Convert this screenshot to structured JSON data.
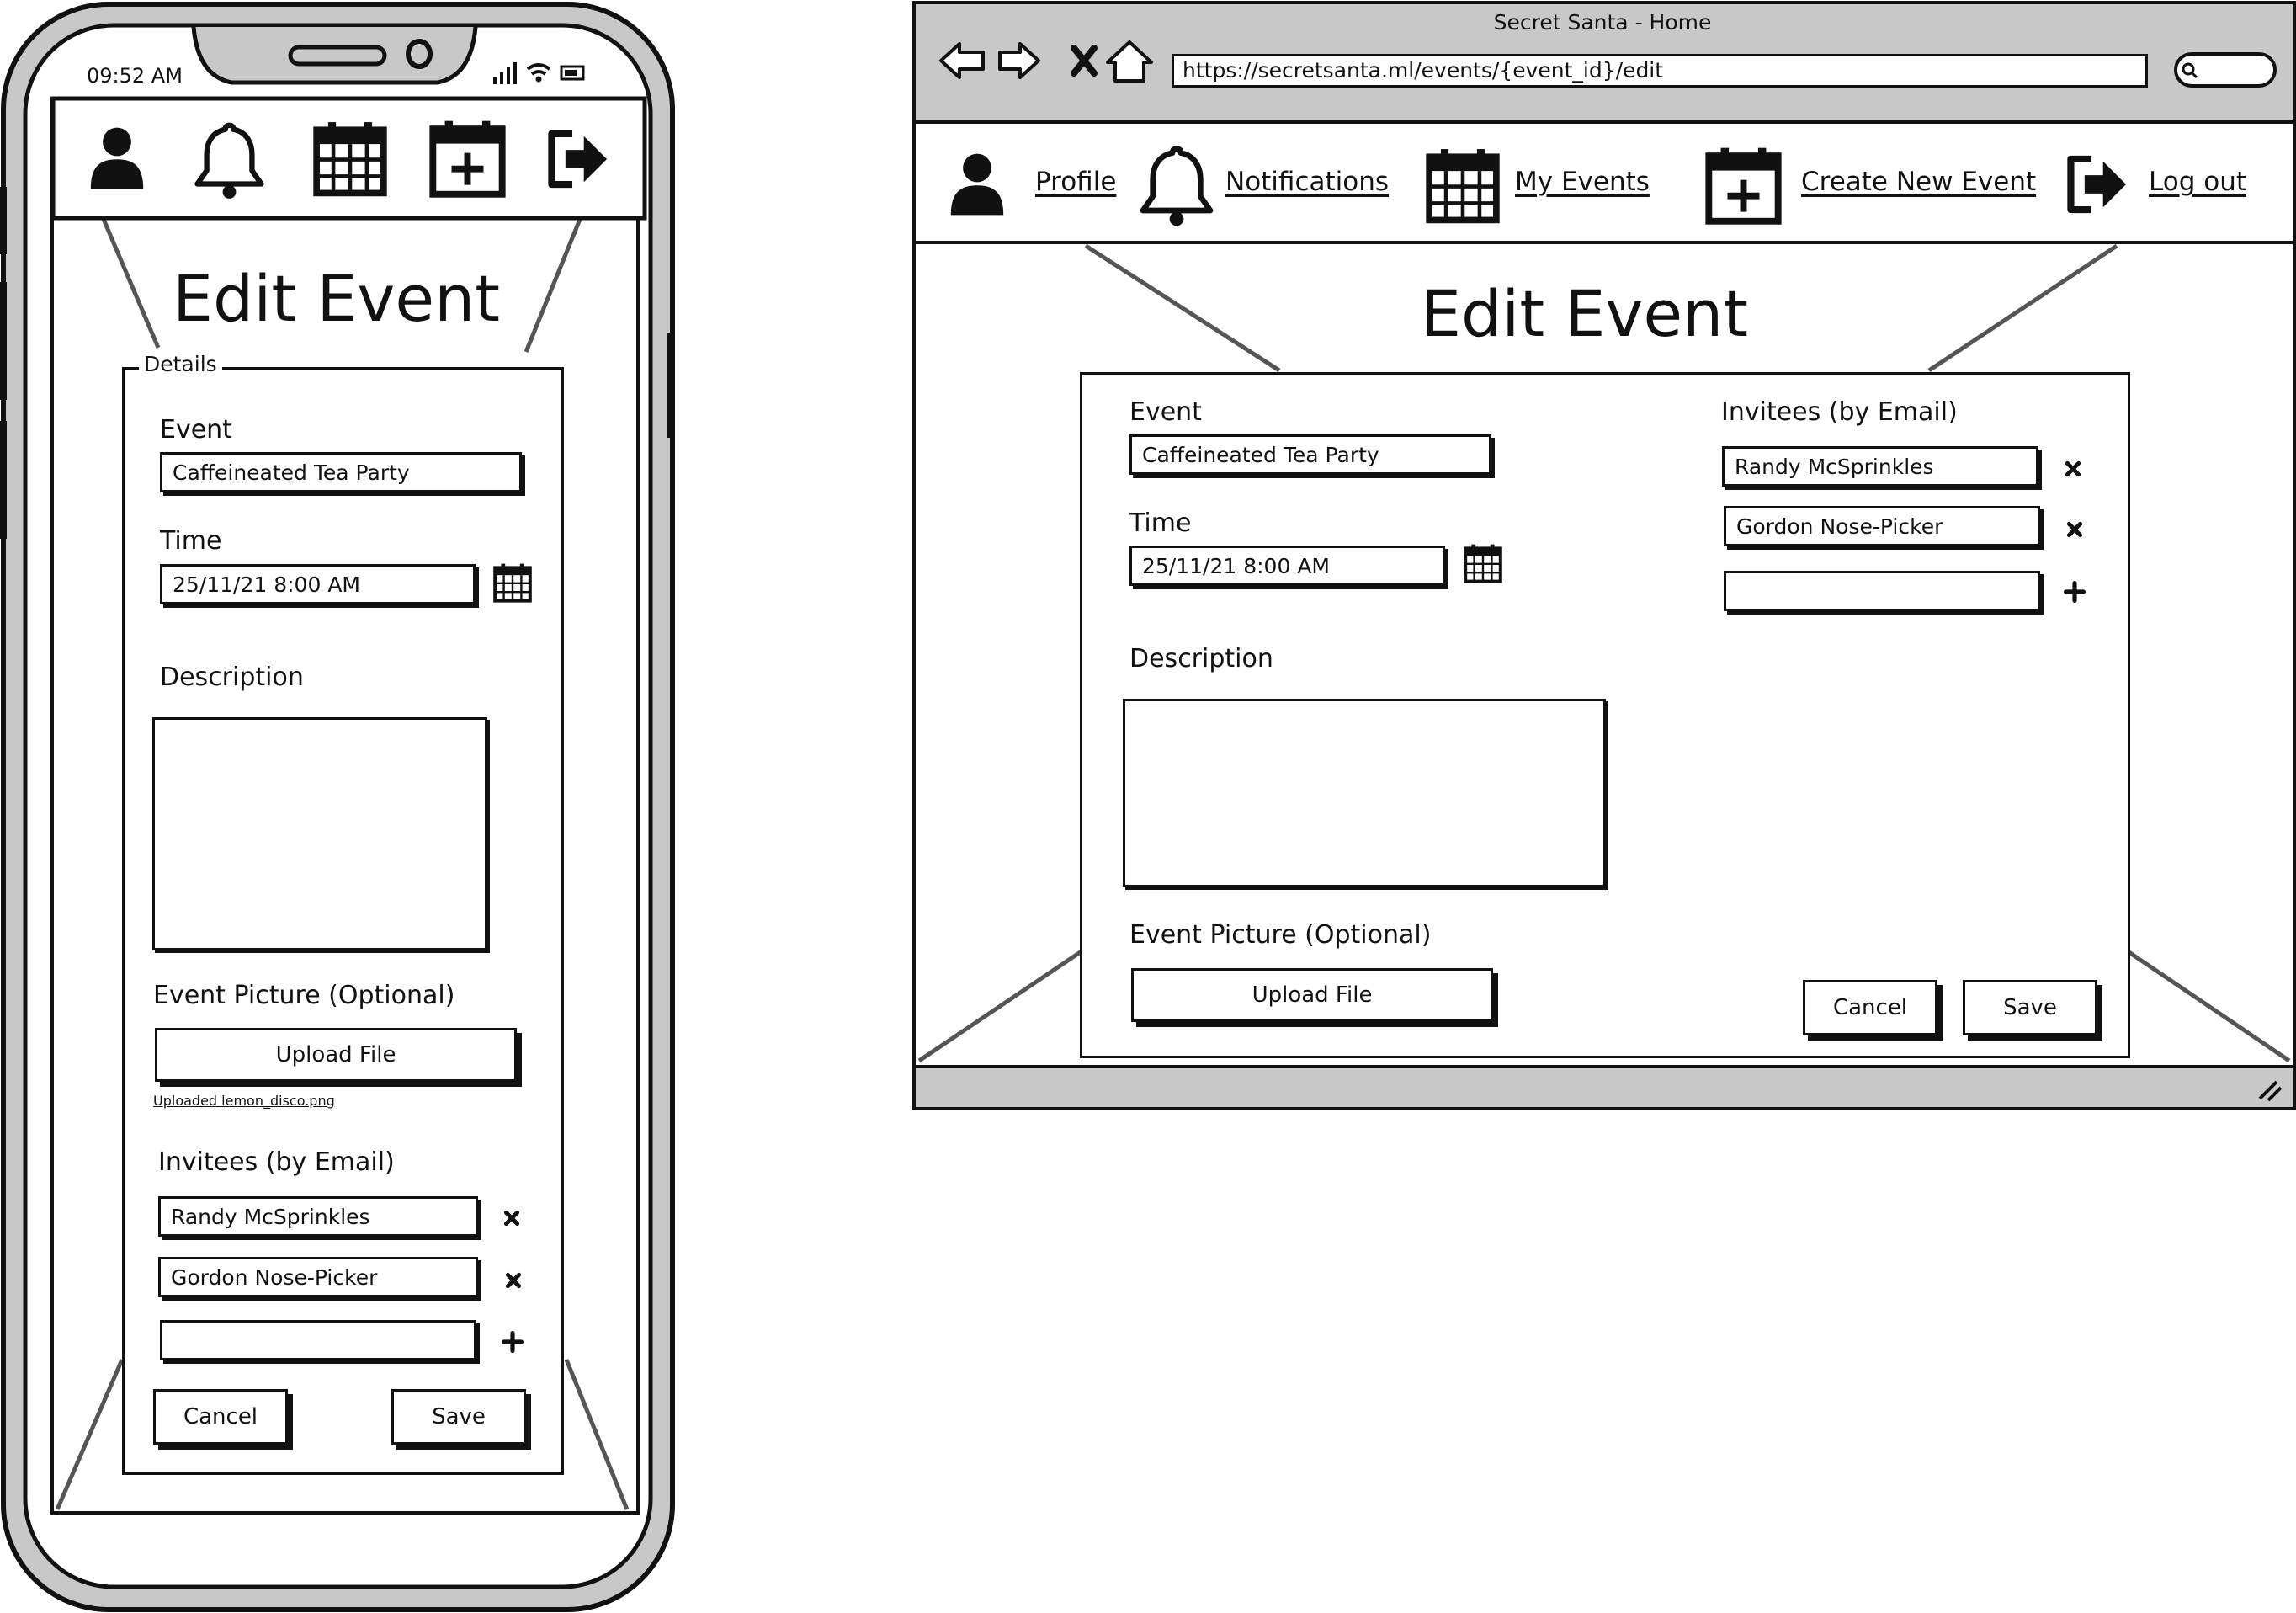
{
  "phone": {
    "status_time": "09:52 AM",
    "page_title": "Edit Event",
    "section_legend": "Details",
    "event_label": "Event",
    "event_value": "Caffeineated Tea Party",
    "time_label": "Time",
    "time_value": "25/11/21 8:00 AM",
    "description_label": "Description",
    "picture_label": "Event Picture (Optional)",
    "upload_label": "Upload File",
    "uploaded_note": "Uploaded lemon_disco.png",
    "invitees_label": "Invitees (by Email)",
    "invitees": [
      "Randy McSprinkles",
      "Gordon Nose-Picker"
    ],
    "cancel_label": "Cancel",
    "save_label": "Save"
  },
  "browser": {
    "window_title": "Secret Santa - Home",
    "url": "https://secretsanta.ml/events/{event_id}/edit",
    "nav": [
      {
        "label": "Profile",
        "icon": "profile-icon"
      },
      {
        "label": "Notifications",
        "icon": "bell-icon"
      },
      {
        "label": "My Events",
        "icon": "calendar-icon"
      },
      {
        "label": "Create New Event",
        "icon": "calendar-plus-icon"
      },
      {
        "label": "Log out",
        "icon": "logout-icon"
      }
    ],
    "page_title": "Edit Event",
    "event_label": "Event",
    "event_value": "Caffeineated Tea Party",
    "time_label": "Time",
    "time_value": "25/11/21 8:00 AM",
    "description_label": "Description",
    "picture_label": "Event Picture (Optional)",
    "upload_label": "Upload File",
    "invitees_label": "Invitees (by Email)",
    "invitees": [
      "Randy McSprinkles",
      "Gordon Nose-Picker"
    ],
    "cancel_label": "Cancel",
    "save_label": "Save"
  }
}
